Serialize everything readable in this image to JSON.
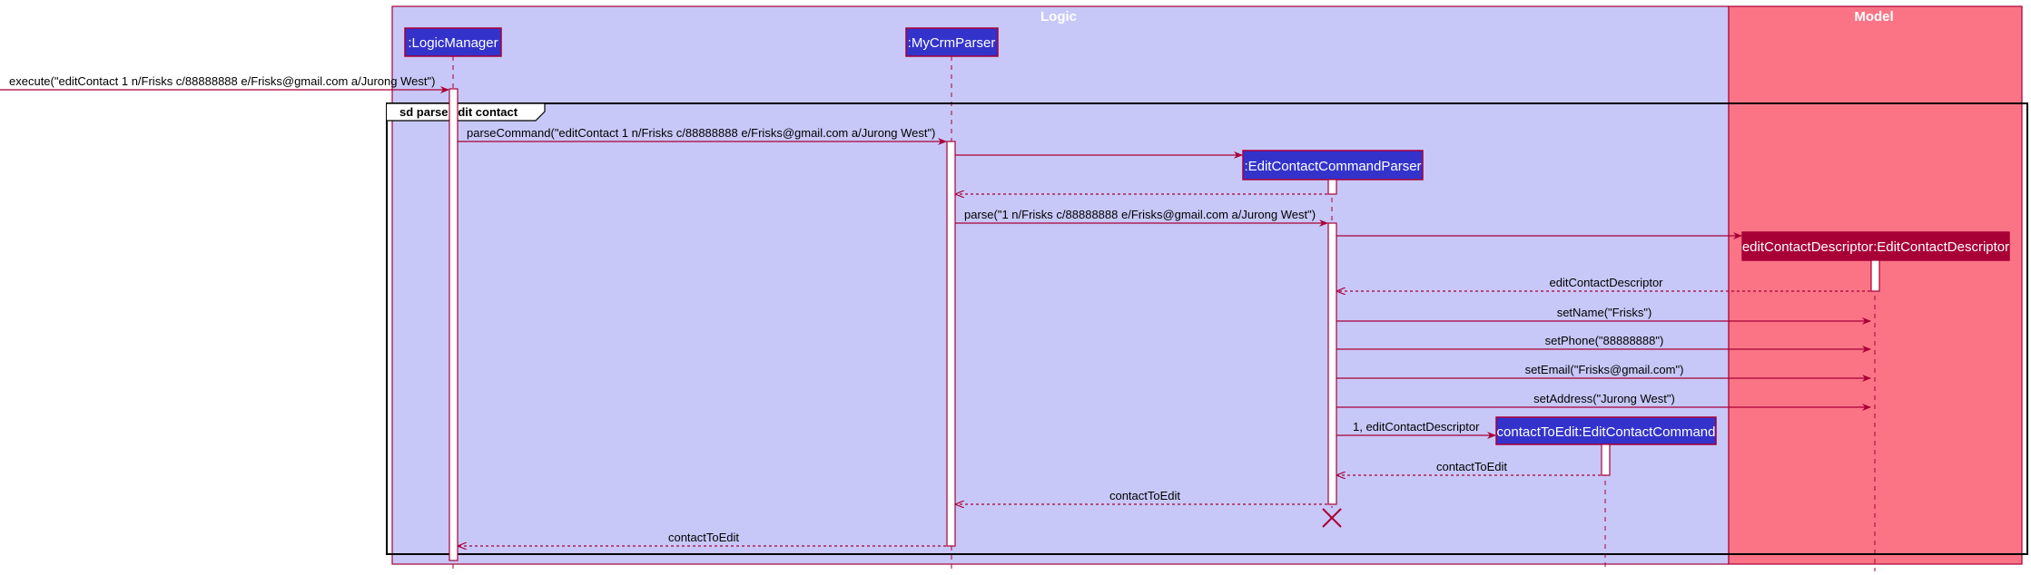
{
  "groups": [
    {
      "id": "logic",
      "label": "Logic"
    },
    {
      "id": "model",
      "label": "Model"
    }
  ],
  "participants": [
    {
      "id": "lm",
      "label": ":LogicManager"
    },
    {
      "id": "parser",
      "label": ":MyCrmParser"
    },
    {
      "id": "ecp",
      "label": ":EditContactCommandParser"
    },
    {
      "id": "ecd",
      "label": "editContactDescriptor:EditContactDescriptor"
    },
    {
      "id": "ecc",
      "label": "contactToEdit:EditContactCommand"
    }
  ],
  "frame": {
    "label": "sd parse edit contact"
  },
  "messages": [
    {
      "id": "m1",
      "label": "execute(\"editContact 1 n/Frisks c/88888888 e/Frisks@gmail.com a/Jurong West\")"
    },
    {
      "id": "m2",
      "label": "parseCommand(\"editContact 1 n/Frisks c/88888888 e/Frisks@gmail.com a/Jurong West\")"
    },
    {
      "id": "m3",
      "label": ""
    },
    {
      "id": "m4",
      "label": ""
    },
    {
      "id": "m5",
      "label": "parse(\"1 n/Frisks c/88888888 e/Frisks@gmail.com a/Jurong West\")"
    },
    {
      "id": "m6",
      "label": ""
    },
    {
      "id": "m7",
      "label": "editContactDescriptor"
    },
    {
      "id": "m8",
      "label": "setName(\"Frisks\")"
    },
    {
      "id": "m9",
      "label": "setPhone(\"88888888\")"
    },
    {
      "id": "m10",
      "label": "setEmail(\"Frisks@gmail.com\")"
    },
    {
      "id": "m11",
      "label": "setAddress(\"Jurong West\")"
    },
    {
      "id": "m12",
      "label": "1, editContactDescriptor"
    },
    {
      "id": "m13",
      "label": "contactToEdit"
    },
    {
      "id": "m14",
      "label": "contactToEdit"
    },
    {
      "id": "m15",
      "label": "contactToEdit"
    }
  ],
  "colors": {
    "logic_bg": "#C8C8F8",
    "model_bg": "#FA7486",
    "group_border": "#A80036",
    "logic_box": "#3333CC",
    "model_box": "#A80036",
    "arrow": "#A80036",
    "frame": "#000000"
  }
}
